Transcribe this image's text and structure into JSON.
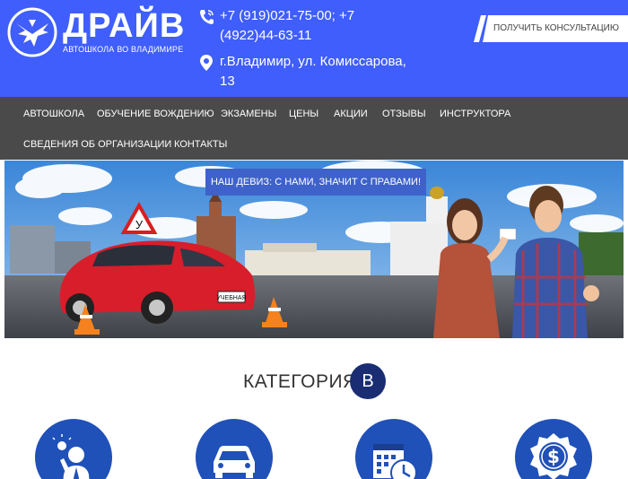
{
  "header": {
    "brand_name": "ДРАЙВ",
    "brand_sub": "АВТОШКОЛА ВО ВЛАДИМИРЕ",
    "phones": "+7 (919)021-75-00; +7 (4922)44-63-11",
    "address": "г.Владимир, ул. Комиссарова, 13",
    "consult_label": "ПОЛУЧИТЬ КОНСУЛЬТАЦИЮ"
  },
  "nav": {
    "items": [
      {
        "label": "АВТОШКОЛА"
      },
      {
        "label": "ОБУЧЕНИЕ ВОЖДЕНИЮ"
      },
      {
        "label": "ЭКЗАМЕНЫ"
      },
      {
        "label": "ЦЕНЫ"
      },
      {
        "label": "АКЦИИ"
      },
      {
        "label": "ОТЗЫВЫ"
      },
      {
        "label": "ИНСТРУКТОРА"
      },
      {
        "label": "СВЕДЕНИЯ ОБ ОРГАНИЗАЦИИ"
      },
      {
        "label": "КОНТАКТЫ"
      }
    ]
  },
  "hero": {
    "motto": "НАШ ДЕВИЗ: С НАМИ, ЗНАЧИТ С ПРАВАМИ!",
    "sign_letter": "У",
    "plate_text": "УЧЕБНАЯ"
  },
  "category": {
    "title": "КАТЕГОРИЯ",
    "badge": "B"
  },
  "features": [
    {
      "icon": "instructor-idea-icon"
    },
    {
      "icon": "car-icon"
    },
    {
      "icon": "calendar-clock-icon"
    },
    {
      "icon": "dollar-badge-icon"
    }
  ],
  "colors": {
    "header_bg": "#3f5efb",
    "nav_bg": "#4a4a4a",
    "motto_bg": "#3e62c9",
    "badge_bg": "#1a2d73",
    "feature_bg": "#2051b8"
  }
}
